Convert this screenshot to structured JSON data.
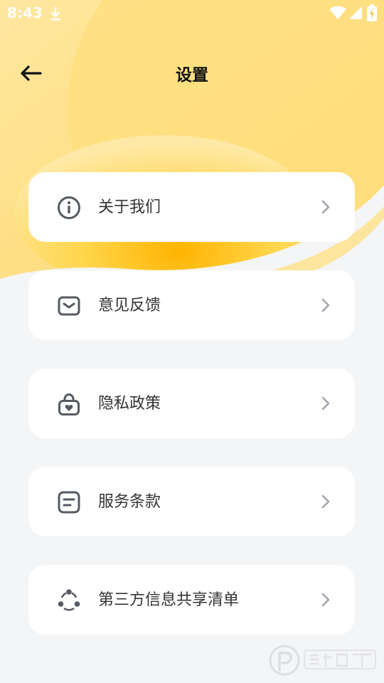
{
  "status_bar": {
    "time": "8:43",
    "icons": [
      "download-icon",
      "wifi-icon",
      "signal-icon",
      "battery-icon"
    ]
  },
  "header": {
    "title": "设置",
    "back_icon": "arrow-left-icon"
  },
  "menu": {
    "items": [
      {
        "label": "关于我们",
        "icon": "info-icon"
      },
      {
        "label": "意见反馈",
        "icon": "feedback-icon"
      },
      {
        "label": "隐私政策",
        "icon": "privacy-lock-icon"
      },
      {
        "label": "服务条款",
        "icon": "terms-icon"
      },
      {
        "label": "第三方信息共享清单",
        "icon": "share-nodes-icon"
      }
    ]
  },
  "colors": {
    "background": "#f4f5f7",
    "accent_yellow": "#ffd23a",
    "card": "#ffffff",
    "text": "#333333",
    "icon": "#555a63",
    "chevron": "#a0a4ab"
  }
}
